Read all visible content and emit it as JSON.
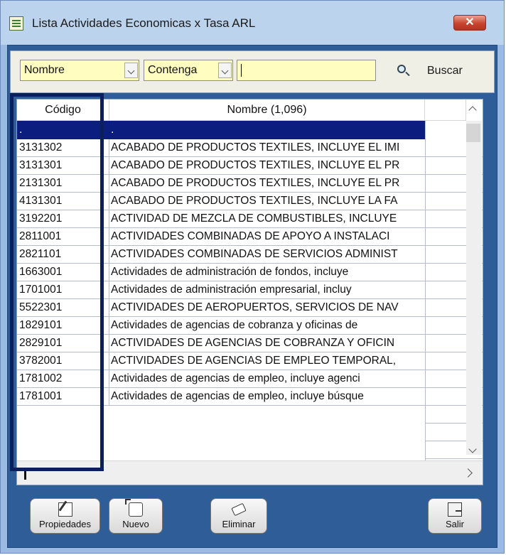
{
  "window": {
    "title": "Lista Actividades Economicas x Tasa ARL",
    "close_label": "✕"
  },
  "toolbar": {
    "field_select": "Nombre",
    "operator_select": "Contenga",
    "search_value": "",
    "search_label": "Buscar"
  },
  "grid": {
    "headers": [
      "Código",
      "Nombre (1,096)"
    ],
    "selected_row": {
      "codigo": ".",
      "nombre": "."
    },
    "rows": [
      {
        "codigo": "3131302",
        "nombre": "ACABADO DE PRODUCTOS TEXTILES, INCLUYE EL IMI"
      },
      {
        "codigo": "3131301",
        "nombre": "ACABADO DE PRODUCTOS TEXTILES, INCLUYE EL PR"
      },
      {
        "codigo": "2131301",
        "nombre": "ACABADO DE PRODUCTOS TEXTILES, INCLUYE EL PR"
      },
      {
        "codigo": "4131301",
        "nombre": "ACABADO DE PRODUCTOS TEXTILES, INCLUYE LA FA"
      },
      {
        "codigo": "3192201",
        "nombre": "ACTIVIDAD DE MEZCLA DE COMBUSTIBLES, INCLUYE"
      },
      {
        "codigo": "2811001",
        "nombre": "ACTIVIDADES COMBINADAS DE APOYO A INSTALACI"
      },
      {
        "codigo": "2821101",
        "nombre": "ACTIVIDADES COMBINADAS DE SERVICIOS ADMINIST"
      },
      {
        "codigo": "1663001",
        "nombre": "Actividades de administración de fondos, incluye"
      },
      {
        "codigo": "1701001",
        "nombre": "Actividades de administración empresarial, incluy"
      },
      {
        "codigo": "5522301",
        "nombre": "ACTIVIDADES DE AEROPUERTOS, SERVICIOS DE NAV"
      },
      {
        "codigo": "1829101",
        "nombre": "Actividades de agencias de cobranza y oficinas de"
      },
      {
        "codigo": "2829101",
        "nombre": "ACTIVIDADES DE AGENCIAS DE COBRANZA Y OFICIN"
      },
      {
        "codigo": "3782001",
        "nombre": "ACTIVIDADES DE AGENCIAS DE EMPLEO TEMPORAL,"
      },
      {
        "codigo": "1781002",
        "nombre": "Actividades de agencias de empleo, incluye agenci"
      },
      {
        "codigo": "1781001",
        "nombre": "Actividades de agencias de empleo, incluye búsque"
      }
    ]
  },
  "buttons": {
    "properties": "Propiedades",
    "new": "Nuevo",
    "delete": "Eliminar",
    "exit": "Salir"
  },
  "colors": {
    "selection": "#0b1d7f",
    "input_background": "#fffec0",
    "highlight_border": "#0b1f5c"
  }
}
